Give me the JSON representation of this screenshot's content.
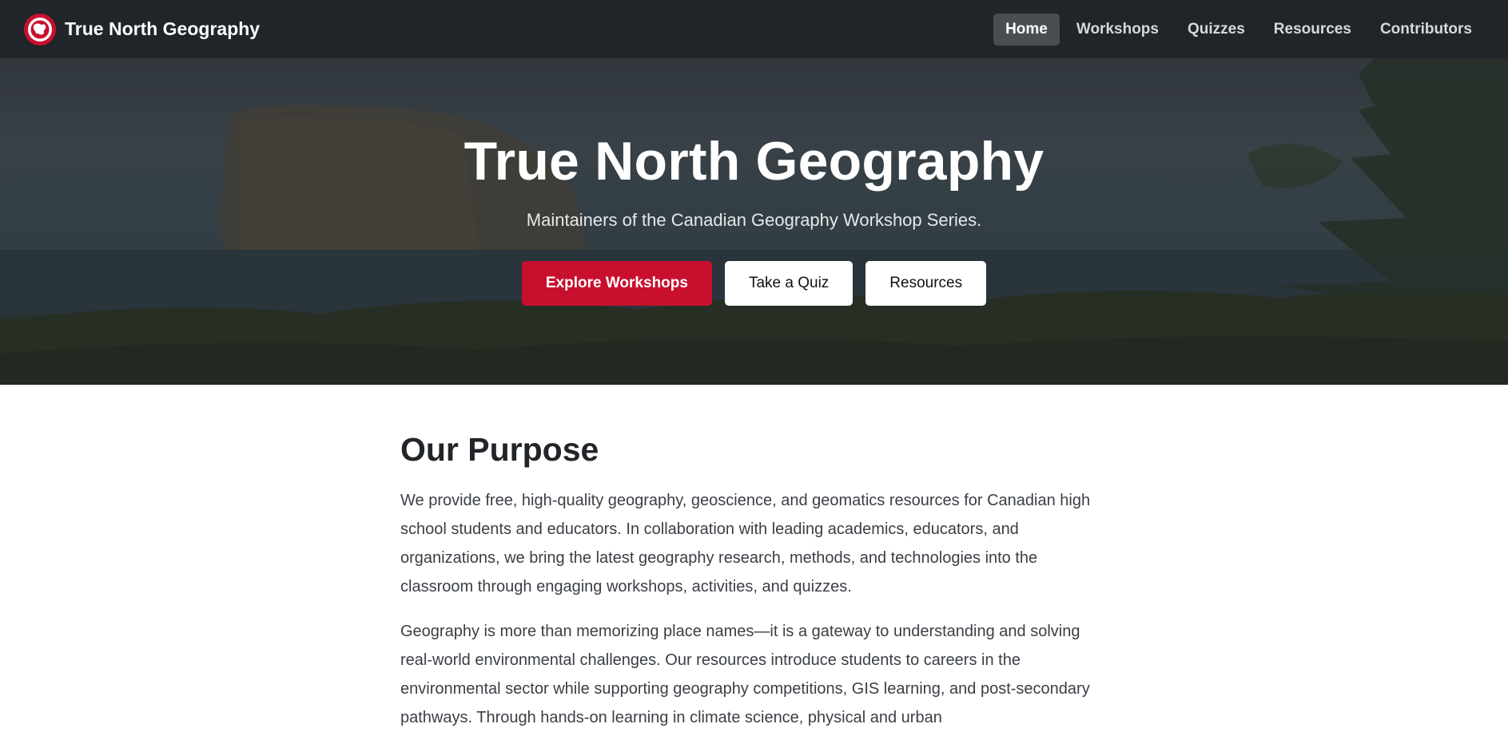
{
  "navbar": {
    "brand": "True North Geography",
    "links": [
      {
        "label": "Home",
        "active": true
      },
      {
        "label": "Workshops",
        "active": false
      },
      {
        "label": "Quizzes",
        "active": false
      },
      {
        "label": "Resources",
        "active": false
      },
      {
        "label": "Contributors",
        "active": false
      }
    ]
  },
  "hero": {
    "title": "True North Geography",
    "subtitle": "Maintainers of the Canadian Geography Workshop Series.",
    "buttons": {
      "explore": "Explore Workshops",
      "quiz": "Take a Quiz",
      "resources": "Resources"
    }
  },
  "purpose": {
    "title": "Our Purpose",
    "paragraphs": [
      "We provide free, high-quality geography, geoscience, and geomatics resources for Canadian high school students and educators. In collaboration with leading academics, educators, and organizations, we bring the latest geography research, methods, and technologies into the classroom through engaging workshops, activities, and quizzes.",
      "Geography is more than memorizing place names—it is a gateway to understanding and solving real-world environmental challenges. Our resources introduce students to careers in the environmental sector while supporting geography competitions, GIS learning, and post-secondary pathways. Through hands-on learning in climate science, physical and urban"
    ]
  },
  "colors": {
    "navbar_bg": "#212529",
    "accent_red": "#c8102e",
    "active_link_bg": "#4a4e53"
  },
  "icons": {
    "brand_logo": "globe-logo-icon"
  }
}
